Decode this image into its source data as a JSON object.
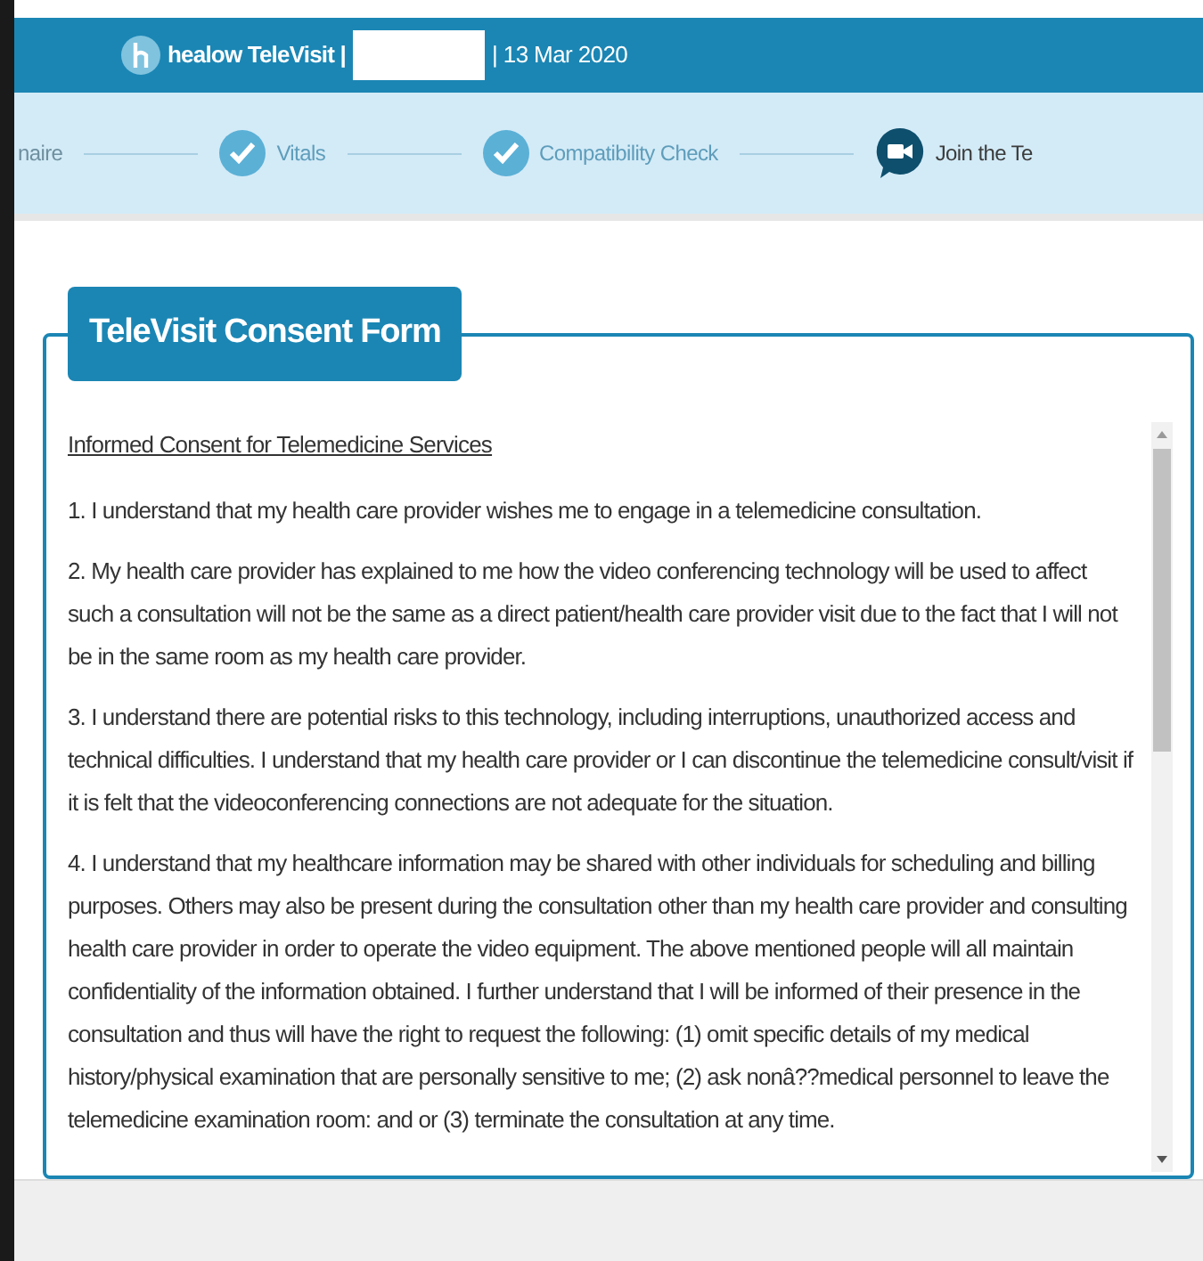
{
  "header": {
    "app_name": "healow TeleVisit |",
    "date": "| 13 Mar 2020"
  },
  "steps": [
    {
      "label": "naire",
      "done": false,
      "kind": "cut"
    },
    {
      "label": "Vitals",
      "done": true,
      "kind": "check"
    },
    {
      "label": "Compatibility Check",
      "done": true,
      "kind": "check"
    },
    {
      "label": "Join the Te",
      "done": false,
      "kind": "video"
    }
  ],
  "form": {
    "title": "TeleVisit Consent Form",
    "heading": "Informed Consent for Telemedicine Services",
    "paragraphs": [
      "1. I understand that my health care provider wishes me to engage in a telemedicine consultation.",
      "2. My health care provider has explained to me how the video conferencing technology will be used to affect such a consultation will not be the same as a direct patient/health care provider visit due to the fact that I will not be in the same room as my health care provider.",
      "3. I understand there are potential risks to this technology, including interruptions, unauthorized access and technical difficulties.  I understand that my health care provider or I can discontinue the telemedicine consult/visit if it is felt that the videoconferencing connections are not adequate for the situation.",
      "4. I understand that my healthcare information may be shared with other individuals for scheduling and billing purposes.  Others may also be present during the consultation other than my health care provider and consulting health care provider in order to operate the video equipment.  The above mentioned people will all maintain confidentiality of the information obtained.  I further understand that I will be informed of their presence in the consultation and thus will have the right to request the following: (1) omit specific details of my medical history/physical examination that are personally sensitive to me; (2) ask nonâ??medical personnel to leave the telemedicine examination room: and or (3) terminate the consultation at any time."
    ]
  }
}
